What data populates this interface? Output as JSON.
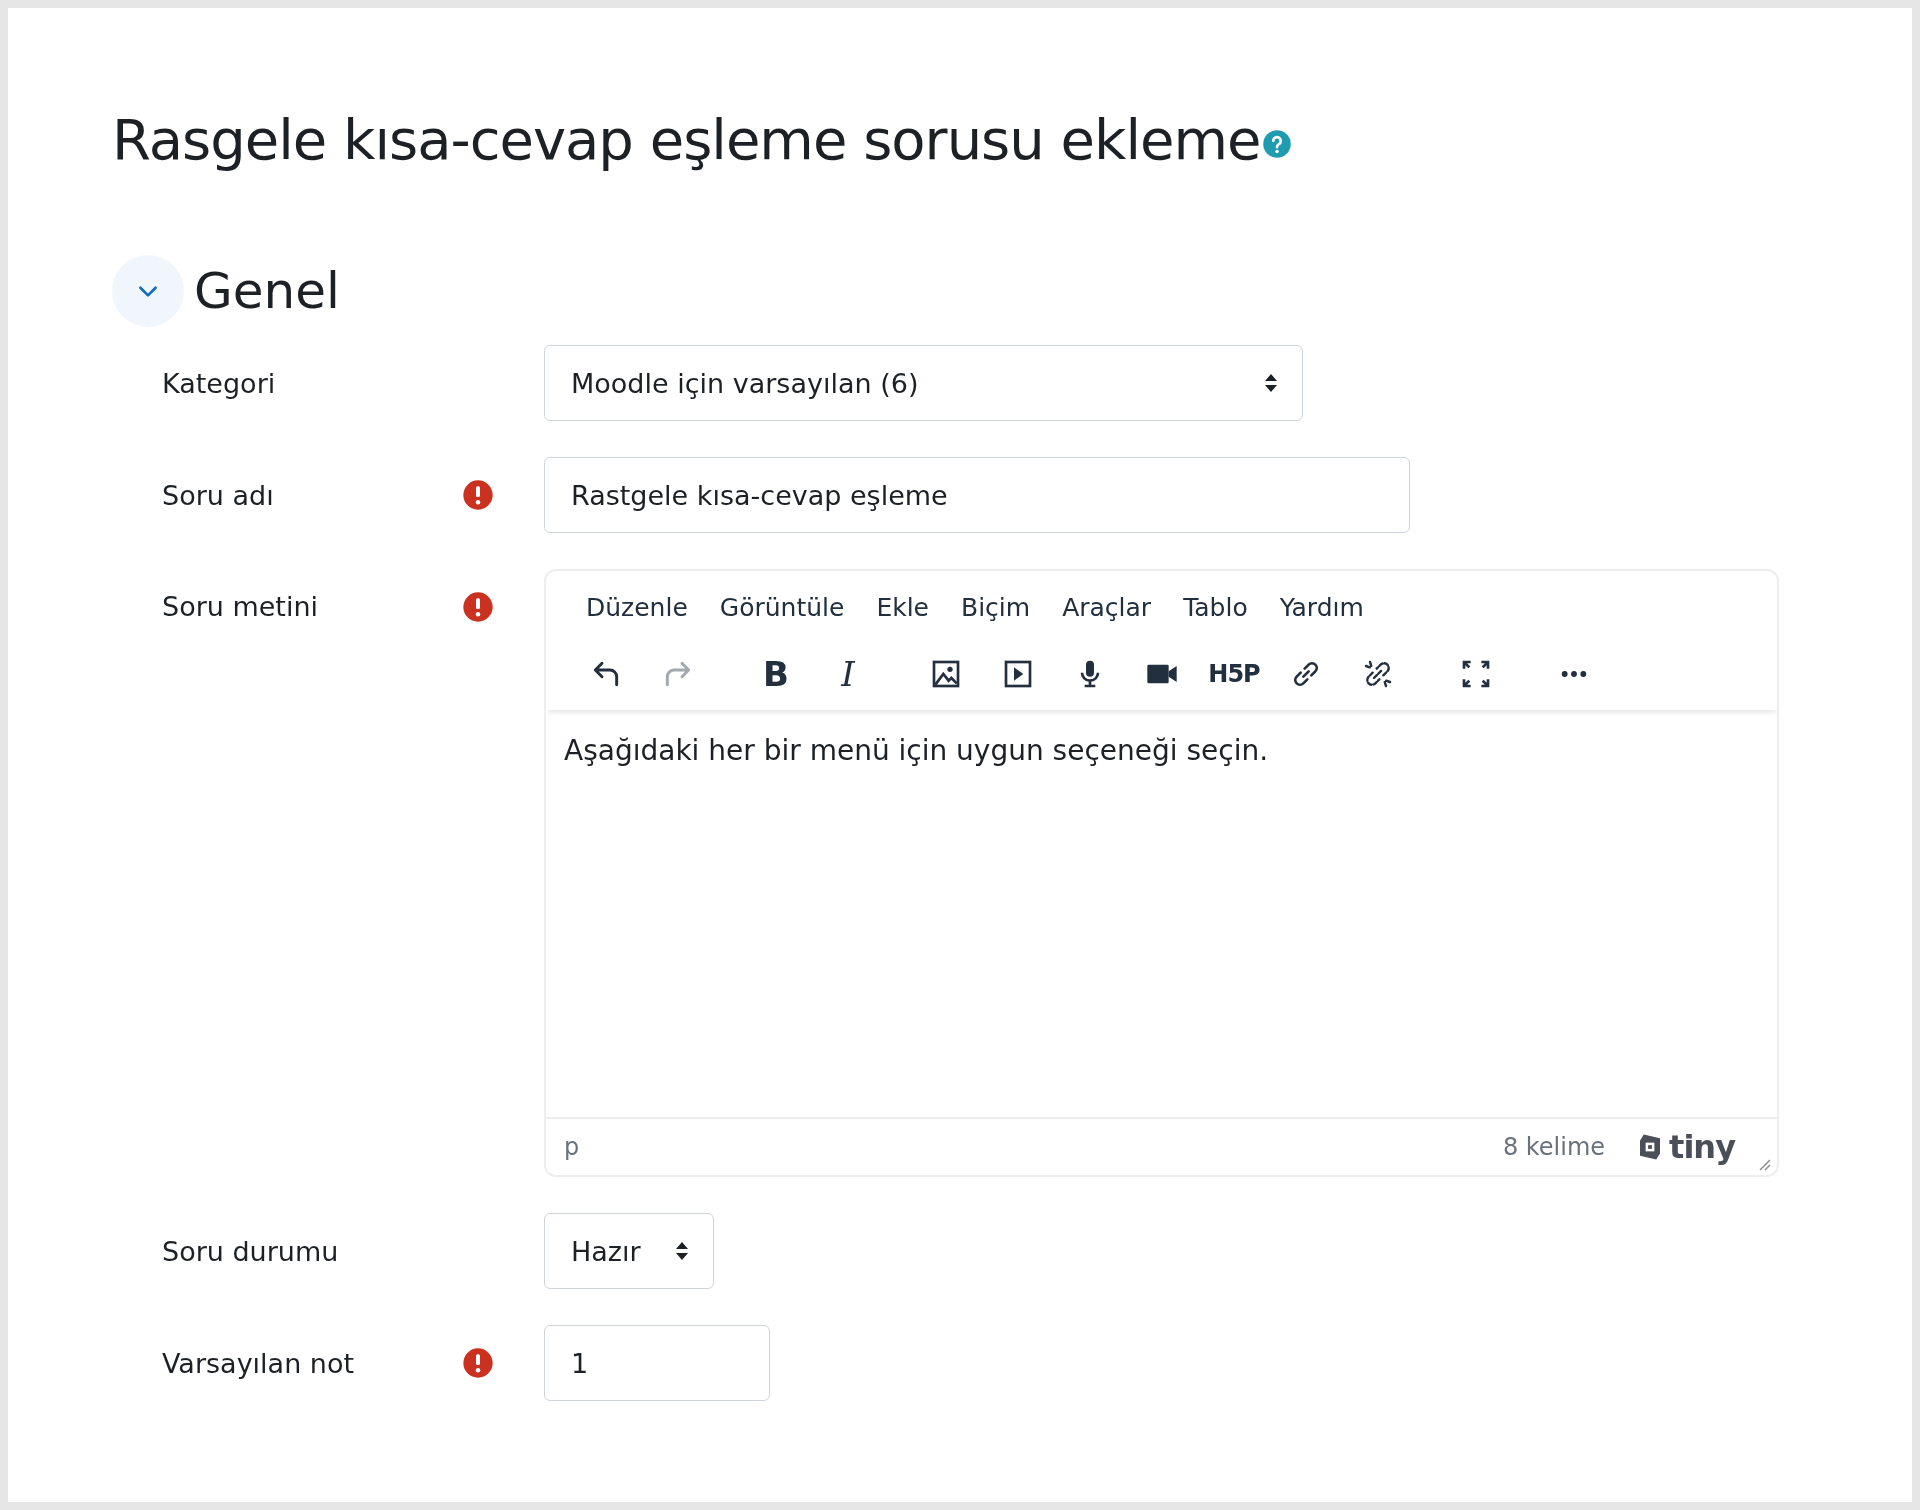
{
  "page": {
    "title": "Rasgele kısa-cevap eşleme sorusu ekleme"
  },
  "section": {
    "title": "Genel",
    "expanded": true
  },
  "fields": [
    {
      "kind": "select",
      "label": "Kategori",
      "required": false,
      "value": "Moodle için varsayılan (6)"
    },
    {
      "kind": "text",
      "label": "Soru adı",
      "required": true,
      "value": "Rastgele kısa-cevap eşleme"
    },
    {
      "kind": "editor",
      "label": "Soru metini",
      "required": true
    },
    {
      "kind": "select",
      "label": "Soru durumu",
      "required": false,
      "value": "Hazır"
    },
    {
      "kind": "text",
      "label": "Varsayılan not",
      "required": true,
      "value": "1"
    }
  ],
  "editor": {
    "menu": [
      "Düzenle",
      "Görüntüle",
      "Ekle",
      "Biçim",
      "Araçlar",
      "Tablo",
      "Yardım"
    ],
    "toolbar": [
      [
        {
          "kind": "undo",
          "disabled": false
        },
        {
          "kind": "redo",
          "disabled": true
        }
      ],
      [
        {
          "kind": "bold",
          "label": "B",
          "disabled": false
        },
        {
          "kind": "italic",
          "label": "I",
          "disabled": false
        }
      ],
      [
        {
          "kind": "image",
          "disabled": false
        },
        {
          "kind": "media",
          "disabled": false
        },
        {
          "kind": "mic",
          "disabled": false
        },
        {
          "kind": "video",
          "disabled": false
        },
        {
          "kind": "logo",
          "label": "H5P",
          "disabled": false
        },
        {
          "kind": "link",
          "disabled": false
        },
        {
          "kind": "unlink",
          "disabled": false
        }
      ],
      [
        {
          "kind": "fullscreen",
          "disabled": false
        }
      ],
      [
        {
          "kind": "more",
          "disabled": false
        }
      ]
    ],
    "content": "Aşağıdaki her bir menü için uygun seçeneği seçin.",
    "path": "p",
    "word_count": "8 kelime",
    "brand": "tiny"
  }
}
